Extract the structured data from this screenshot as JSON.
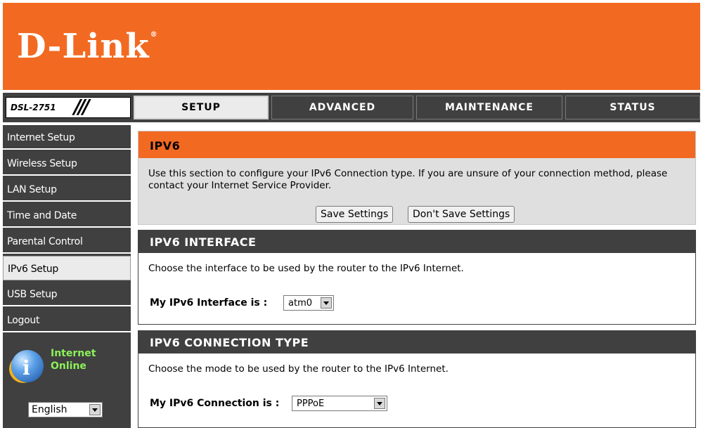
{
  "brand": {
    "logo_text": "D-Link",
    "registered": "®",
    "model": "DSL-2751",
    "accent_color": "#f26a22",
    "dark_color": "#404040"
  },
  "nav": {
    "tabs": [
      {
        "label": "SETUP",
        "active": true
      },
      {
        "label": "ADVANCED",
        "active": false
      },
      {
        "label": "MAINTENANCE",
        "active": false
      },
      {
        "label": "STATUS",
        "active": false
      }
    ]
  },
  "sidebar": {
    "items": [
      {
        "label": "Internet Setup",
        "active": false
      },
      {
        "label": "Wireless Setup",
        "active": false
      },
      {
        "label": "LAN Setup",
        "active": false
      },
      {
        "label": "Time and Date",
        "active": false
      },
      {
        "label": "Parental Control",
        "active": false
      },
      {
        "label": "IPv6 Setup",
        "active": true
      },
      {
        "label": "USB Setup",
        "active": false
      },
      {
        "label": "Logout",
        "active": false
      }
    ],
    "status_line1": "Internet",
    "status_line2": "Online",
    "status_icon": "info-globe-icon",
    "status_color": "#8cf05a",
    "language": {
      "selected": "English"
    }
  },
  "ipv6": {
    "title": "IPV6",
    "description": "Use this section to configure your IPv6 Connection type. If you are unsure of your connection method, please contact your Internet Service Provider.",
    "save_label": "Save Settings",
    "dont_save_label": "Don't Save Settings"
  },
  "interface_section": {
    "title": "IPV6 INTERFACE",
    "description": "Choose the interface to be used by the router to the IPv6 Internet.",
    "field_label": "My IPv6 Interface is :",
    "selected": "atm0"
  },
  "connection_section": {
    "title": "IPV6 CONNECTION TYPE",
    "description": "Choose the mode to be used by the router to the IPv6 Internet.",
    "field_label": "My IPv6 Connection is :",
    "selected": "PPPoE"
  }
}
